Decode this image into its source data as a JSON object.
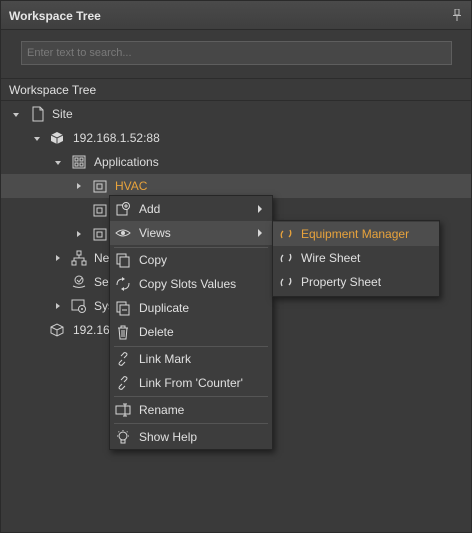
{
  "panel": {
    "title": "Workspace Tree"
  },
  "search": {
    "placeholder": "Enter text to search..."
  },
  "section": {
    "label": "Workspace Tree"
  },
  "tree": {
    "site": "Site",
    "host": "192.168.1.52:88",
    "applications": "Applications",
    "hvac": "HVAC",
    "network": "Ne",
    "services": "Ser",
    "system": "Sys",
    "host2": "192.16"
  },
  "context_menu": {
    "add": "Add",
    "views": "Views",
    "copy": "Copy",
    "copy_slots": "Copy Slots Values",
    "duplicate": "Duplicate",
    "delete": "Delete",
    "link_mark": "Link Mark",
    "link_from": "Link From 'Counter'",
    "rename": "Rename",
    "show_help": "Show Help"
  },
  "views_menu": {
    "equipment_manager": "Equipment Manager",
    "wire_sheet": "Wire Sheet",
    "property_sheet": "Property Sheet"
  },
  "colors": {
    "accent": "#e8a33c",
    "background": "#3a3a3a",
    "menu": "#3d3d3d"
  }
}
